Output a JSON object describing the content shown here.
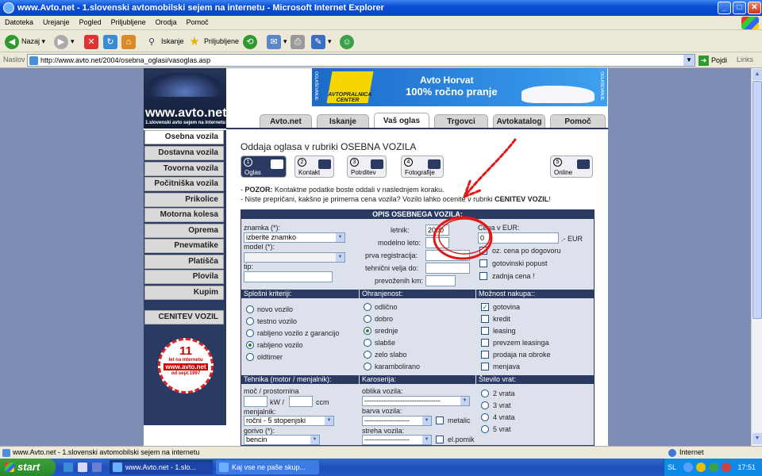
{
  "window": {
    "title": "www.Avto.net - 1.slovenski avtomobilski sejem na internetu - Microsoft Internet Explorer",
    "minimize": "_",
    "maximize": "□",
    "close": "✕"
  },
  "menu": [
    "Datoteka",
    "Urejanje",
    "Pogled",
    "Priljubljene",
    "Orodja",
    "Pomoč"
  ],
  "toolbar": {
    "back": "Nazaj",
    "search": "Iskanje",
    "favorites": "Priljubljene"
  },
  "address": {
    "label": "Naslov",
    "url": "http://www.avto.net/2004/osebna_oglasi/vasoglas.asp",
    "go": "Pojdi",
    "links": "Links"
  },
  "site": {
    "logo_name": "www.avto.net",
    "logo_sub": "1.slovenski avto sejem na internetu",
    "banner": {
      "side_left": "OGLAŠEVANJE",
      "side_right": "OGLAŠEVANJE",
      "sign": "AVTOPRALNICA CENTER",
      "title": "Avto Horvat",
      "subtitle": "100% ročno pranje"
    },
    "tabs": [
      "Avto.net",
      "Iskanje",
      "Vaš oglas",
      "Trgovci",
      "Avtokatalog",
      "Pomoč"
    ],
    "active_tab": "Vaš oglas",
    "nav": [
      "Osebna vozila",
      "Dostavna vozila",
      "Tovorna vozila",
      "Počitniška vozila",
      "Prikolice",
      "Motorna kolesa",
      "Oprema",
      "Pnevmatike",
      "Platišča",
      "Plovila",
      "Kupim",
      "CENITEV VOZIL"
    ],
    "badge": {
      "num": "11",
      "l1": "let na internetu",
      "l2": "www.avto.net",
      "l3": "od sept.1997"
    }
  },
  "main": {
    "heading": "Oddaja oglasa v rubriki OSEBNA VOZILA",
    "steps": [
      {
        "n": "1",
        "label": "Oglas"
      },
      {
        "n": "2",
        "label": "Kontakt"
      },
      {
        "n": "3",
        "label": "Potrditev"
      },
      {
        "n": "4",
        "label": "Fotografije"
      },
      {
        "n": "5",
        "label": "Online"
      }
    ],
    "notice1_bold": "POZOR:",
    "notice1": " Kontaktne podatke boste oddali v naslednjem koraku.",
    "notice2": "- Niste prepričani, kakšno je primerna cena vozila? Vozilo lahko ocenite v rubriki ",
    "notice2_bold": "CENITEV VOZIL",
    "notice2_end": "!"
  },
  "form": {
    "title": "OPIS OSEBNEGA VOZILA:",
    "znamka_label": "znamka (*):",
    "znamka_value": "izberite znamko",
    "model_label": "model (*):",
    "tip_label": "tip:",
    "letnik_label": "letnik:",
    "letnik_value": "2000",
    "modelno_label": "modelno leto:",
    "prva_reg_label": "prva registracija:",
    "tehnicni_label": "tehnični velja do:",
    "km_label": "prevoženih km:",
    "cena_label": "Cena v EUR:",
    "cena_value": "0",
    "cena_unit": ".- EUR",
    "cena_opts": [
      "oz. cena po dogovoru",
      "gotovinski popust",
      "zadnja cena !"
    ],
    "splosni_title": "Splošni kriteriji:",
    "splosni": [
      "novo vozilo",
      "testno vozilo",
      "rabljeno vozilo z garancijo",
      "rabljeno vozilo",
      "oldtimer"
    ],
    "ohranjenost_title": "Ohranjenost:",
    "ohranjenost": [
      "odlično",
      "dobro",
      "srednje",
      "slabše",
      "zelo slabo",
      "karambolirano"
    ],
    "nakup_title": "Možnost nakupa::",
    "nakup": [
      "gotovina",
      "kredit",
      "leasing",
      "prevzem leasinga",
      "prodaja na obroke",
      "menjava"
    ],
    "tehnika_title": "Tehnika (motor / menjalnik):",
    "moc_label": "moč / prostornina",
    "kw": "kW /",
    "ccm": "ccm",
    "menjalnik_label": "menjalnik:",
    "menjalnik_value": "ročni - 5 stopenjski",
    "gorivo_label": "gorivo (*):",
    "gorivo_value": "bencin",
    "karoserija_title": "Karoserija:",
    "oblika_label": "oblika vozila:",
    "oblika_value": "--------------------------------",
    "barva_label": "barva vozila:",
    "barva_value": "-------------------",
    "metalic": "metalic",
    "streha_label": "streha vozila:",
    "streha_value": "-------------------",
    "elpomik": "el.pomik",
    "vrata_title": "Število vrat:",
    "vrata": [
      "2 vrata",
      "3 vrat",
      "4 vrata",
      "5 vrat"
    ]
  },
  "status": {
    "text": "www.Avto.net - 1.slovenski avtomobilski sejem na internetu",
    "zone": "Internet"
  },
  "taskbar": {
    "start": "start",
    "tasks": [
      "www.Avto.net - 1.slo...",
      "Kaj vse ne paše skup..."
    ],
    "lang": "SL",
    "clock": "17:51"
  }
}
